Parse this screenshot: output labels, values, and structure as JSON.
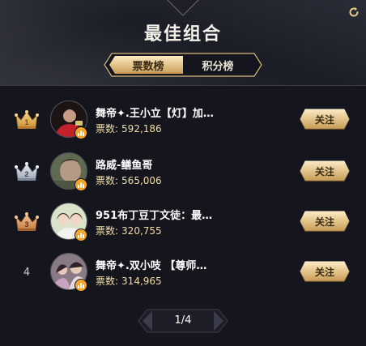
{
  "header": {
    "title": "最佳组合"
  },
  "tabs": [
    {
      "label": "票数榜",
      "active": true
    },
    {
      "label": "积分榜",
      "active": false
    }
  ],
  "entries": [
    {
      "rank": 1,
      "name": "舞帝✦.王小立【灯】加…",
      "votes_label": "票数:",
      "votes": "592,186",
      "follow_label": "关注",
      "medal": "gold"
    },
    {
      "rank": 2,
      "name": "路威-鳝鱼哥",
      "votes_label": "票数:",
      "votes": "565,006",
      "follow_label": "关注",
      "medal": "silver"
    },
    {
      "rank": 3,
      "name": "951布丁豆丁文徒：最…",
      "votes_label": "票数:",
      "votes": "320,755",
      "follow_label": "关注",
      "medal": "bronze"
    },
    {
      "rank": "4",
      "name": "舞帝✦.双小吱 【尊师…",
      "votes_label": "票数:",
      "votes": "314,965",
      "follow_label": "关注",
      "medal": "none"
    }
  ],
  "pagination": {
    "text": "1/4",
    "current": 1,
    "total": 4
  },
  "colors": {
    "gold": "#e8c98a",
    "bg": "#14151d",
    "votes": "#f2dca4",
    "badge": "#f0a52a"
  },
  "icons": {
    "refresh": "refresh-icon",
    "prev": "chevron-left-icon",
    "next": "chevron-right-icon",
    "live": "live-bars-icon"
  }
}
